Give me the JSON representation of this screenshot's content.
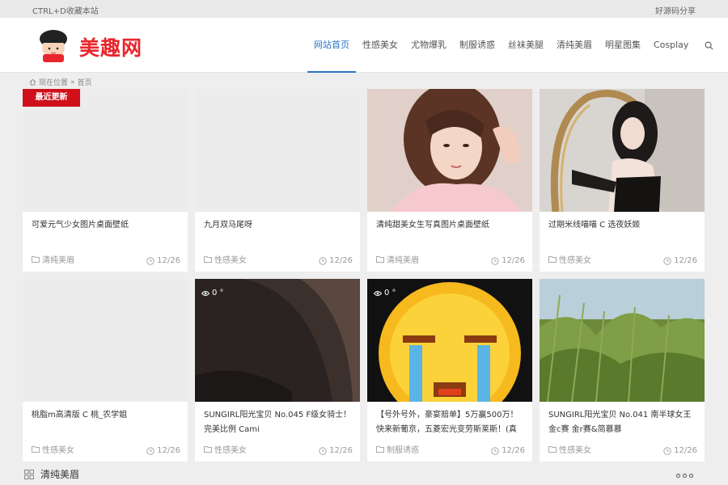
{
  "topbar": {
    "left_text": "CTRL+D收藏本站",
    "right_text": "好源码分享"
  },
  "site": {
    "name": "美趣网"
  },
  "nav": {
    "items": [
      "网站首页",
      "性感美女",
      "尤物爆乳",
      "制服诱惑",
      "丝袜美腿",
      "清纯美眉",
      "明星图集",
      "Cosplay"
    ],
    "active_index": 0
  },
  "breadcrumb": {
    "location": "现在位置",
    "separator": "»",
    "current": "首页"
  },
  "badge": {
    "label": "最近更新"
  },
  "cards": [
    {
      "title": "可爱元气少女图片桌面壁纸",
      "category": "清纯美眉",
      "date": "12/26",
      "views": ""
    },
    {
      "title": "九月双马尾呀",
      "category": "性感美女",
      "date": "12/26",
      "views": ""
    },
    {
      "title": "清纯甜美女生写真图片桌面壁纸",
      "category": "清纯美眉",
      "date": "12/26",
      "views": ""
    },
    {
      "title": "过期米线喵喵 C 选夜妖姬",
      "category": "性感美女",
      "date": "12/26",
      "views": ""
    },
    {
      "title": "桃脂m高清版 C 桃_农学姐",
      "category": "性感美女",
      "date": "12/26",
      "views": ""
    },
    {
      "title": "SUNGIRL阳光宝贝 No.045 F级女骑士！完美比例 Cami",
      "category": "性感美女",
      "date": "12/26",
      "views": "0 °"
    },
    {
      "title": "【号外号外，豪宴赔单】5万赢500万！快来新葡京，五菱宏光变劳斯莱斯！(真",
      "category": "制服诱惑",
      "date": "12/26",
      "views": "0 °"
    },
    {
      "title": "SUNGIRL阳光宝贝 No.041 南半球女王金c赛 金r赛&简慕慕",
      "category": "性感美女",
      "date": "12/26",
      "views": ""
    }
  ],
  "section": {
    "title": "清纯美眉"
  },
  "colors": {
    "accent": "#2f74c4",
    "brand_red": "#e8262d",
    "badge_red": "#d0101a"
  }
}
